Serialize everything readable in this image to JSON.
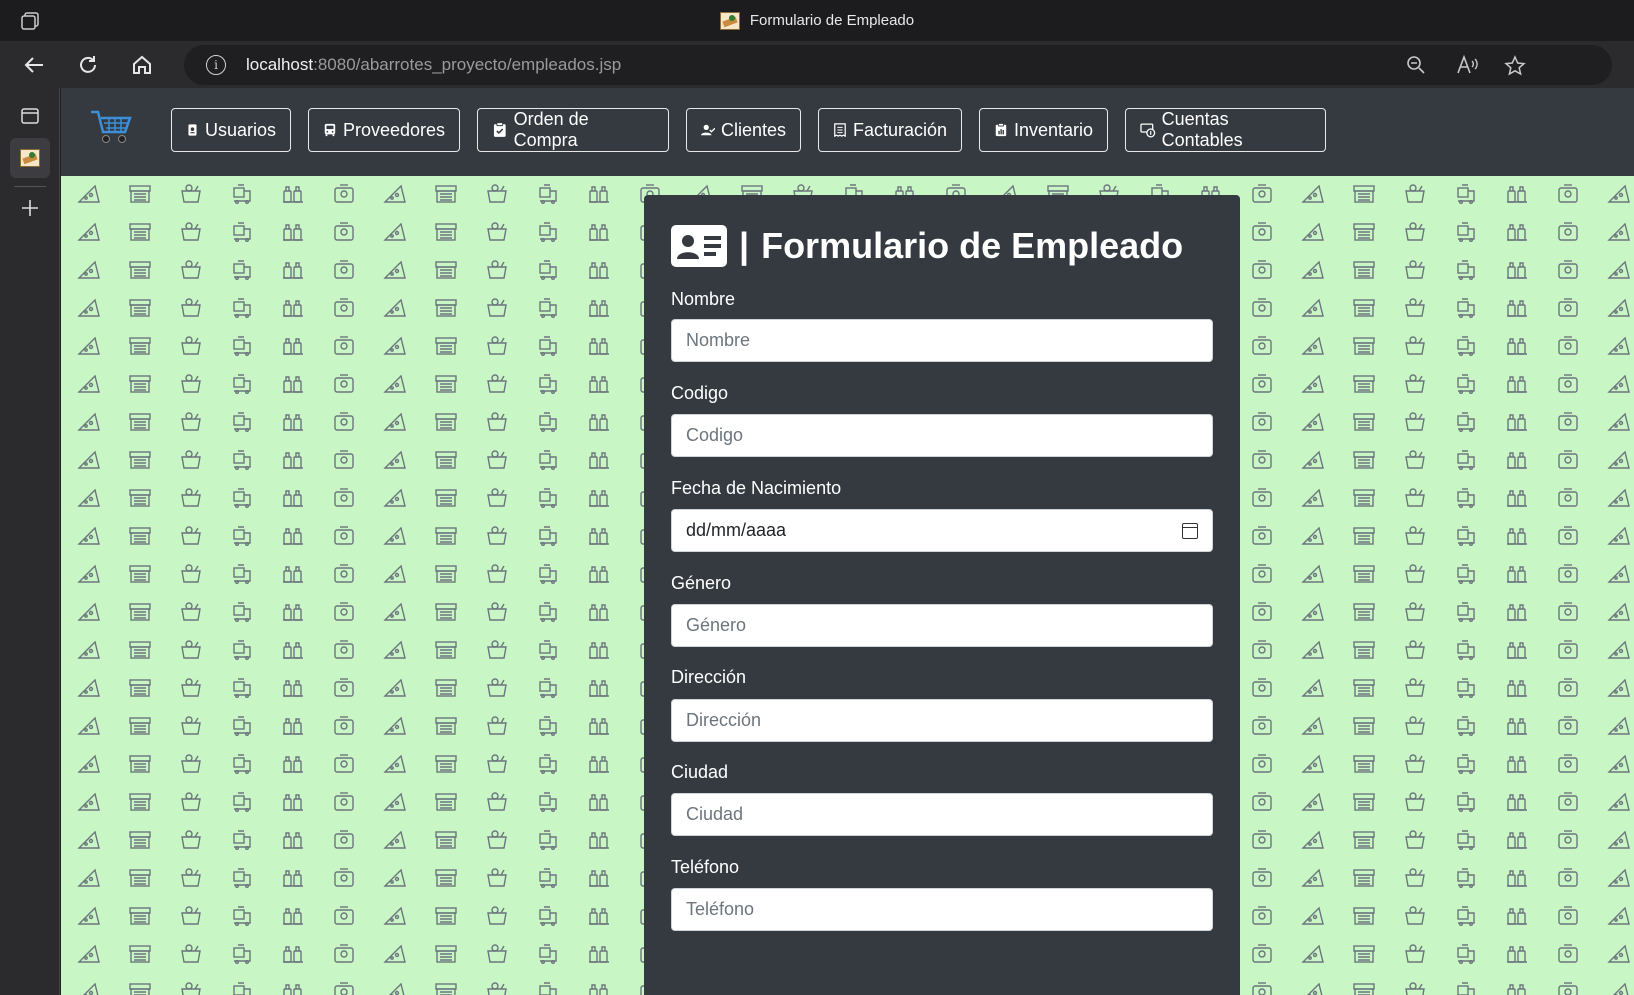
{
  "browser": {
    "tab_title": "Formulario de Empleado",
    "url_host": "localhost",
    "url_rest": ":8080/abarrotes_proyecto/empleados.jsp"
  },
  "navbar": {
    "items": [
      {
        "label": "Usuarios",
        "icon": "user-badge-icon"
      },
      {
        "label": "Proveedores",
        "icon": "bus-icon"
      },
      {
        "label": "Orden de Compra",
        "icon": "clipboard-check-icon"
      },
      {
        "label": "Clientes",
        "icon": "person-check-icon"
      },
      {
        "label": "Facturación",
        "icon": "receipt-icon"
      },
      {
        "label": "Inventario",
        "icon": "clipboard-data-icon"
      },
      {
        "label": "Cuentas Contables",
        "icon": "cash-coin-icon"
      }
    ]
  },
  "form": {
    "title_separator": "|",
    "title": "Formulario de Empleado",
    "fields": [
      {
        "label": "Nombre",
        "placeholder": "Nombre"
      },
      {
        "label": "Codigo",
        "placeholder": "Codigo"
      },
      {
        "label": "Fecha de Nacimiento",
        "placeholder": "dd/mm/aaaa"
      },
      {
        "label": "Género",
        "placeholder": "Género"
      },
      {
        "label": "Dirección",
        "placeholder": "Dirección"
      },
      {
        "label": "Ciudad",
        "placeholder": "Ciudad"
      },
      {
        "label": "Teléfono",
        "placeholder": "Teléfono"
      }
    ]
  },
  "colors": {
    "navbar_bg": "#343a40",
    "pattern_bg": "#c8f7c5",
    "pattern_icon": "#6c757d"
  }
}
